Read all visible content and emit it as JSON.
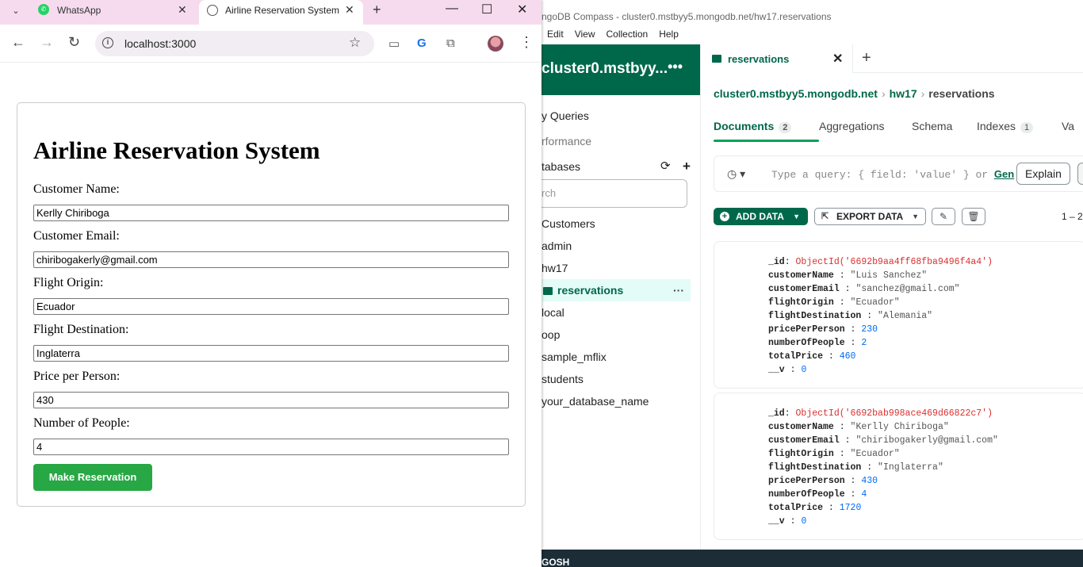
{
  "compass": {
    "window_title": "ngoDB Compass - cluster0.mstbyy5.mongodb.net/hw17.reservations",
    "menu": [
      "Edit",
      "View",
      "Collection",
      "Help"
    ],
    "connection_name": "cluster0.mstbyy...",
    "nav": {
      "queries": "y Queries",
      "performance": "rformance",
      "databases": "tabases"
    },
    "search_placeholder": "rch",
    "databases": [
      {
        "name": "Customers"
      },
      {
        "name": "admin"
      },
      {
        "name": "hw17"
      },
      {
        "name": "reservations",
        "active": true
      },
      {
        "name": "local"
      },
      {
        "name": "oop"
      },
      {
        "name": "sample_mflix"
      },
      {
        "name": "students"
      },
      {
        "name": "your_database_name"
      }
    ],
    "tab": {
      "title": "reservations"
    },
    "breadcrumb": {
      "cluster": "cluster0.mstbyy5.mongodb.net",
      "db": "hw17",
      "collection": "reservations"
    },
    "subtabs": {
      "documents": "Documents",
      "documents_count": "2",
      "aggregations": "Aggregations",
      "schema": "Schema",
      "indexes": "Indexes",
      "indexes_count": "1",
      "validation": "Va"
    },
    "query": {
      "placeholder": "Type a query: { field: 'value' } or ",
      "generate": "Gen",
      "explain": "Explain"
    },
    "toolbar": {
      "add_data": "ADD DATA",
      "export_data": "EXPORT DATA",
      "range": "1 – 2"
    },
    "documents": [
      {
        "_id": "ObjectId('6692b9aa4ff68fba9496f4a4')",
        "customerName": "\"Luis Sanchez\"",
        "customerEmail": "\"sanchez@gmail.com\"",
        "flightOrigin": "\"Ecuador\"",
        "flightDestination": "\"Alemania\"",
        "pricePerPerson": "230",
        "numberOfPeople": "2",
        "totalPrice": "460",
        "__v": "0"
      },
      {
        "_id": "ObjectId('6692bab998ace469d66822c7')",
        "customerName": "\"Kerlly Chiriboga\"",
        "customerEmail": "\"chiribogakerly@gmail.com\"",
        "flightOrigin": "\"Ecuador\"",
        "flightDestination": "\"Inglaterra\"",
        "pricePerPerson": "430",
        "numberOfPeople": "4",
        "totalPrice": "1720",
        "__v": "0"
      }
    ],
    "shell_label": "GOSH"
  },
  "browser": {
    "tabs": [
      {
        "title": "WhatsApp",
        "icon": "whatsapp-icon"
      },
      {
        "title": "Airline Reservation System",
        "icon": "globe-icon",
        "active": true
      }
    ],
    "url": "localhost:3000"
  },
  "form": {
    "heading": "Airline Reservation System",
    "fields": [
      {
        "label": "Customer Name:",
        "value": "Kerlly Chiriboga"
      },
      {
        "label": "Customer Email:",
        "value": "chiribogakerly@gmail.com"
      },
      {
        "label": "Flight Origin:",
        "value": "Ecuador"
      },
      {
        "label": "Flight Destination:",
        "value": "Inglaterra"
      },
      {
        "label": "Price per Person:",
        "value": "430"
      },
      {
        "label": "Number of People:",
        "value": "4"
      }
    ],
    "submit": "Make Reservation"
  },
  "colors": {
    "compass_green": "#00684a",
    "button_green": "#28a745",
    "tab_strip": "#f6dbee"
  }
}
